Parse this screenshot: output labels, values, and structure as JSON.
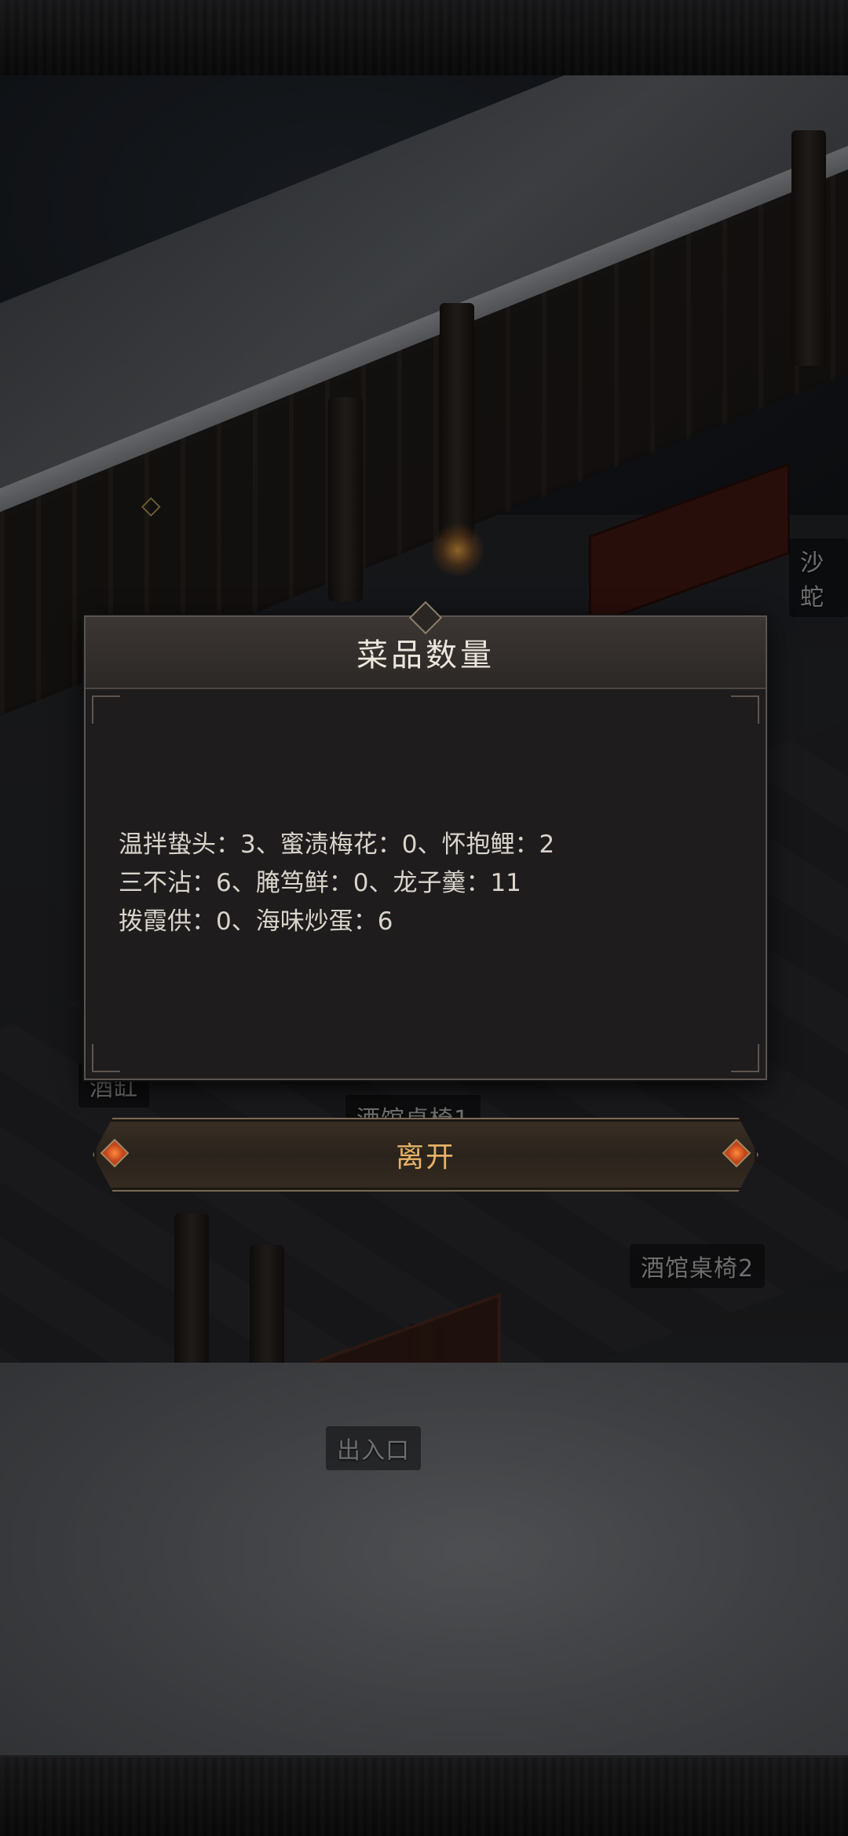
{
  "dialog": {
    "title": "菜品数量",
    "lines": [
      "温拌蛰头：3、蜜渍梅花：0、怀抱鲤：2",
      "三不沾：6、腌笃鲜：0、龙子羹：11",
      "拨霞供：0、海味炒蛋：6"
    ]
  },
  "buttons": {
    "leave_label": "离开"
  },
  "scene_labels": {
    "shashe": "沙蛇",
    "jiugang": "酒缸",
    "table1": "酒馆桌椅1",
    "table2": "酒馆桌椅2",
    "entrance": "出入口"
  },
  "colors": {
    "button_text": "#e8b366",
    "title_text": "#ece6dc",
    "body_text": "#d9d4cc",
    "gem": "#c2441b"
  }
}
